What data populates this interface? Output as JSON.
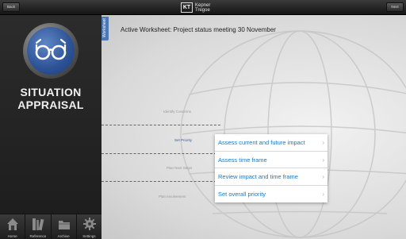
{
  "topbar": {
    "back_label": "Back",
    "next_label": "Next",
    "logo_mark": "KT",
    "logo_line1": "Kepner",
    "logo_line2": "Tregoe"
  },
  "sidebar": {
    "title_line1": "SITUATION",
    "title_line2": "APPRAISAL",
    "badge_icon": "eyeglasses-icon",
    "nav": [
      {
        "label": "Home",
        "icon": "home-icon"
      },
      {
        "label": "Reference",
        "icon": "books-icon"
      },
      {
        "label": "Archive",
        "icon": "folder-icon"
      },
      {
        "label": "Settings",
        "icon": "gear-icon"
      }
    ]
  },
  "main": {
    "side_tab_label": "Worksheet",
    "worksheet_title": "Active Worksheet: Project status meeting 30 November",
    "steps": [
      {
        "label": "Identify Concerns",
        "active": false
      },
      {
        "label": "Set Priority",
        "active": true
      },
      {
        "label": "Plan Next Steps",
        "active": false
      },
      {
        "label": "Plan Involvement",
        "active": false
      }
    ]
  },
  "popup": {
    "items": [
      {
        "label": "Assess current and future impact"
      },
      {
        "label": "Assess time frame"
      },
      {
        "label": "Review impact and time frame"
      },
      {
        "label": "Set overall priority"
      }
    ],
    "chevron": "›"
  },
  "colors": {
    "accent_blue": "#1a78c2",
    "badge_blue": "#2c5296",
    "sidebar_bg": "#242424"
  }
}
